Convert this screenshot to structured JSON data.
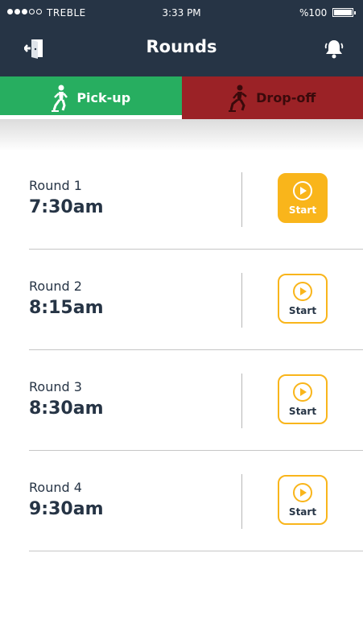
{
  "status_bar": {
    "carrier": "TREBLE",
    "time": "3:33 PM",
    "battery_text": "%100",
    "signal_full": 3,
    "signal_total": 5
  },
  "header": {
    "title": "Rounds",
    "exit_icon": "exit-door-icon",
    "notification_icon": "bell-icon"
  },
  "tabs": [
    {
      "label": "Pick-up",
      "icon": "walking-person-icon",
      "selected": true
    },
    {
      "label": "Drop-off",
      "icon": "running-person-icon",
      "selected": false
    }
  ],
  "rounds": [
    {
      "name": "Round 1",
      "time": "7:30am",
      "button_label": "Start",
      "active": true
    },
    {
      "name": "Round 2",
      "time": "8:15am",
      "button_label": "Start",
      "active": false
    },
    {
      "name": "Round 3",
      "time": "8:30am",
      "button_label": "Start",
      "active": false
    },
    {
      "name": "Round 4",
      "time": "9:30am",
      "button_label": "Start",
      "active": false
    }
  ],
  "colors": {
    "header_bg": "#263445",
    "pickup_green": "#27ae60",
    "dropoff_red": "#9b2226",
    "accent_yellow": "#f9b51b",
    "text_dark": "#263445"
  }
}
